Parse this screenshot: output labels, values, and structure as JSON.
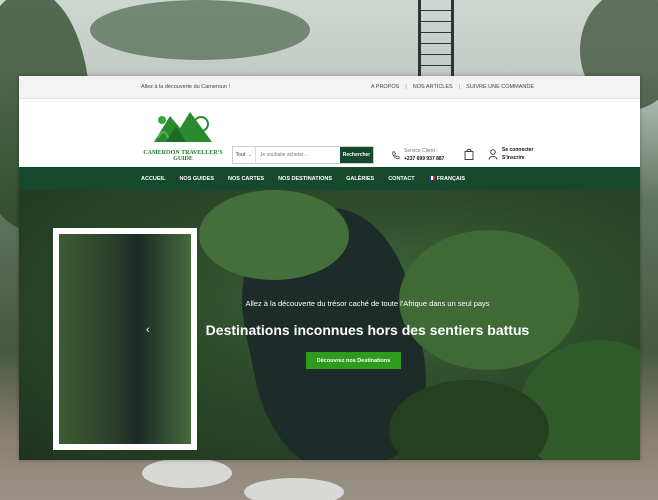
{
  "topbar": {
    "welcome": "Allez à la découverte du Cameroun !",
    "links": [
      "A PROPOS",
      "NOS ARTICLES",
      "SUIVRE UNE COMMANDE"
    ]
  },
  "logo": {
    "name": "CAMEROON TRAVELLER'S GUIDE"
  },
  "search": {
    "category": "Tout",
    "placeholder": "Je souhaite acheter...",
    "button": "Rechercher"
  },
  "service": {
    "label": "Service Client :",
    "phone": "+237 699 937 887"
  },
  "account": {
    "login": "Se connecter",
    "register": "S'inscrire"
  },
  "nav": {
    "items": [
      "ACCUEIL",
      "NOS GUIDES",
      "NOS CARTES",
      "NOS DESTINATIONS",
      "GALÉRIES",
      "CONTACT"
    ],
    "language": "FRANÇAIS"
  },
  "hero": {
    "subtitle": "Allez à la découverte du trésor caché de toute l'Afrique dans un seul pays",
    "title": "Destinations inconnues hors des sentiers battus",
    "cta": "Découvrez nos Destinations"
  },
  "colors": {
    "brand_green": "#16482d",
    "cta_green": "#2d9c1e"
  }
}
